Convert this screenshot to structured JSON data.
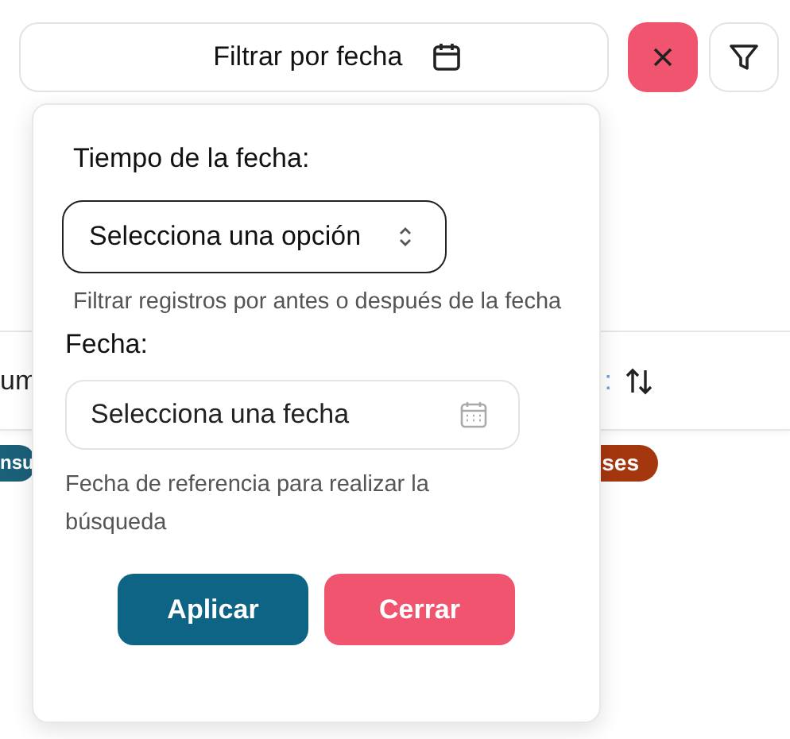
{
  "filter_bar": {
    "date_button": "Filtrar por fecha"
  },
  "background": {
    "header": {
      "column_1": "um",
      "column_2": ":"
    },
    "badges": [
      {
        "label": "nsu",
        "color": "#1b6079"
      },
      {
        "label": "ses",
        "color": "#a5370f"
      }
    ]
  },
  "popover": {
    "time_label": "Tiempo de la fecha:",
    "time_select": {
      "value": "Selecciona una opción"
    },
    "time_hint": "Filtrar registros por antes o después de la fecha",
    "date_label": "Fecha:",
    "date_field": {
      "placeholder": "Selecciona una fecha"
    },
    "date_hint": "Fecha de referencia para realizar la búsqueda",
    "buttons": [
      {
        "label": "Aplicar",
        "kind": "primary"
      },
      {
        "label": "Cerrar",
        "kind": "danger"
      }
    ]
  }
}
